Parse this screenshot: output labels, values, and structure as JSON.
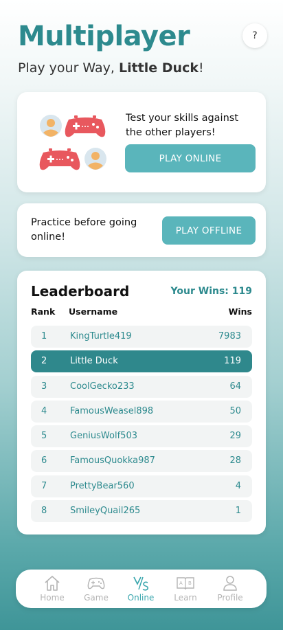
{
  "header": {
    "title": "Multiplayer",
    "help_label": "?",
    "subtitle_prefix": "Play your Way, ",
    "subtitle_name": "Little Duck",
    "subtitle_suffix": "!"
  },
  "online_card": {
    "text": "Test your skills against the other players!",
    "button": "PLAY ONLINE"
  },
  "offline_card": {
    "text": "Practice before going online!",
    "button": "PLAY OFFLINE"
  },
  "leaderboard": {
    "title": "Leaderboard",
    "your_wins": "Your Wins: 119",
    "columns": [
      "Rank",
      "Username",
      "Wins"
    ],
    "rows": [
      {
        "rank": "1",
        "username": "KingTurtle419",
        "wins": "7983"
      },
      {
        "rank": "2",
        "username": "Little Duck",
        "wins": "119"
      },
      {
        "rank": "3",
        "username": "CoolGecko233",
        "wins": "64"
      },
      {
        "rank": "4",
        "username": "FamousWeasel898",
        "wins": "50"
      },
      {
        "rank": "5",
        "username": "GeniusWolf503",
        "wins": "29"
      },
      {
        "rank": "6",
        "username": "FamousQuokka987",
        "wins": "28"
      },
      {
        "rank": "7",
        "username": "PrettyBear560",
        "wins": "4"
      },
      {
        "rank": "8",
        "username": "SmileyQuail265",
        "wins": "1"
      }
    ]
  },
  "nav": [
    {
      "label": "Home",
      "icon": "home-icon"
    },
    {
      "label": "Game",
      "icon": "gamepad-icon"
    },
    {
      "label": "Online",
      "icon": "versus-icon"
    },
    {
      "label": "Learn",
      "icon": "book-icon"
    },
    {
      "label": "Profile",
      "icon": "person-icon"
    }
  ],
  "colors": {
    "accent": "#2d8a8e",
    "button": "#5ab5bb",
    "highlight_row": "#2f888c",
    "controller": "#e8585e",
    "nav_active": "#3aa6ad"
  }
}
